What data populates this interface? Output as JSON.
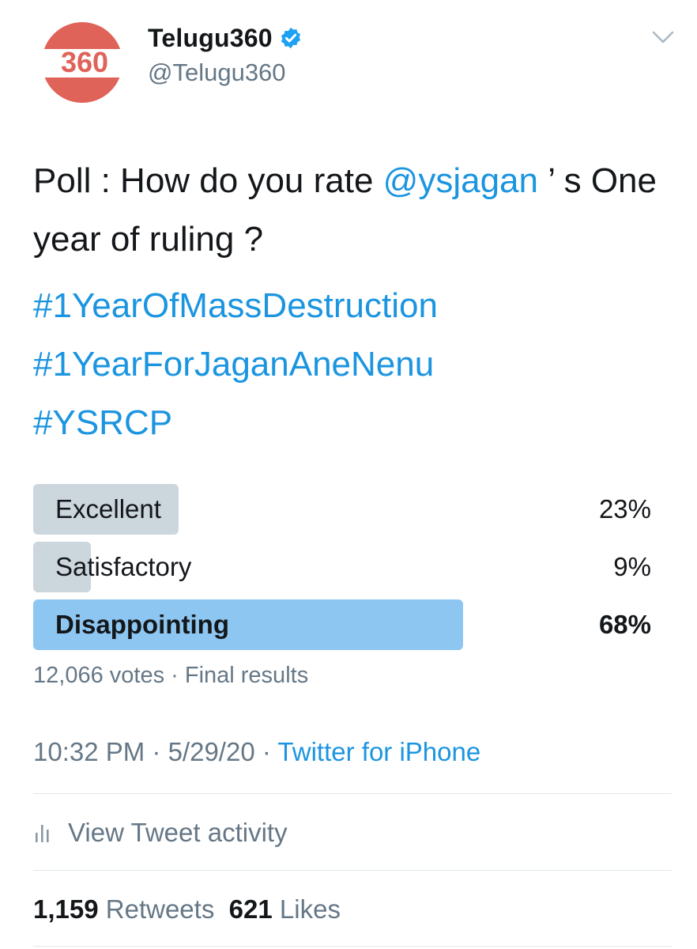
{
  "user": {
    "avatar_text": "360",
    "display_name": "Telugu360",
    "handle": "@Telugu360"
  },
  "tweet": {
    "text_before": "Poll :  How do you rate ",
    "mention": "@ysjagan",
    "text_after": " ’ s One year of ruling ?",
    "hashtags": [
      "#1YearOfMassDestruction",
      "#1YearForJaganAneNenu",
      "#YSRCP"
    ]
  },
  "poll": {
    "options": [
      {
        "label": "Excellent",
        "percent_text": "23%",
        "fraction": 0.23,
        "winner": false
      },
      {
        "label": "Satisfactory",
        "percent_text": "9%",
        "fraction": 0.09,
        "winner": false
      },
      {
        "label": "Disappointing",
        "percent_text": "68%",
        "fraction": 0.68,
        "winner": true
      }
    ],
    "votes": "12,066 votes",
    "status": "Final results"
  },
  "meta": {
    "time": "10:32 PM",
    "date": "5/29/20",
    "source": "Twitter for iPhone"
  },
  "activity": {
    "label": "View Tweet activity",
    "icon": "bar-chart-icon"
  },
  "stats": {
    "retweets_count": "1,159",
    "retweets_label": "Retweets",
    "likes_count": "621",
    "likes_label": "Likes"
  },
  "colors": {
    "link": "#1b95e0",
    "avatar_bg": "#e0635a",
    "poll_bar": "#ccd6dd",
    "poll_winner_bar": "#8ec6f2"
  }
}
